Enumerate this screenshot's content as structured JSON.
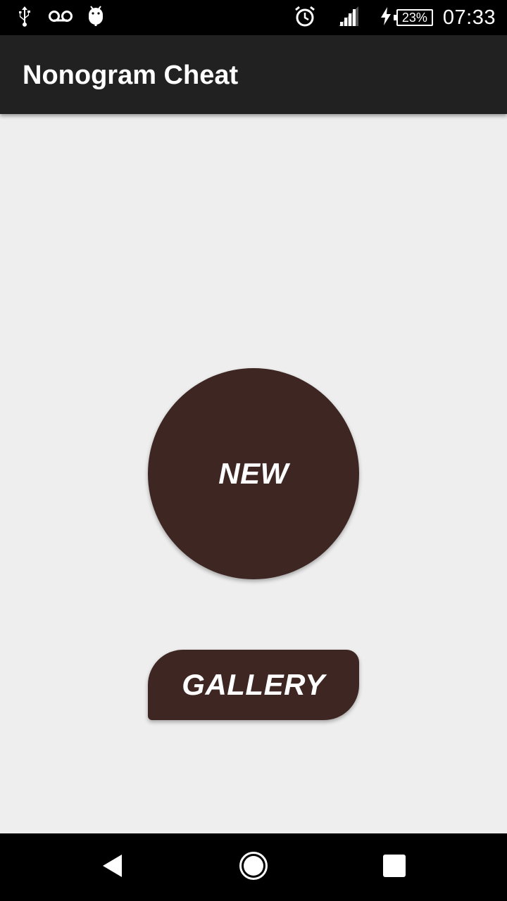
{
  "status_bar": {
    "time": "07:33",
    "battery_percent": "23%",
    "left_icons": [
      "usb-icon",
      "voicemail-icon",
      "android-debug-icon"
    ],
    "right_icons": [
      "alarm-icon",
      "signal-icon",
      "charging-icon",
      "battery-icon"
    ]
  },
  "app_bar": {
    "title": "Nonogram Cheat"
  },
  "main": {
    "new_label": "NEW",
    "gallery_label": "GALLERY"
  },
  "nav_bar": {
    "icons": [
      "back-icon",
      "home-icon",
      "recents-icon"
    ]
  },
  "colors": {
    "button": "#3e2723",
    "app_bar": "#212121",
    "background": "#eeeeee"
  }
}
